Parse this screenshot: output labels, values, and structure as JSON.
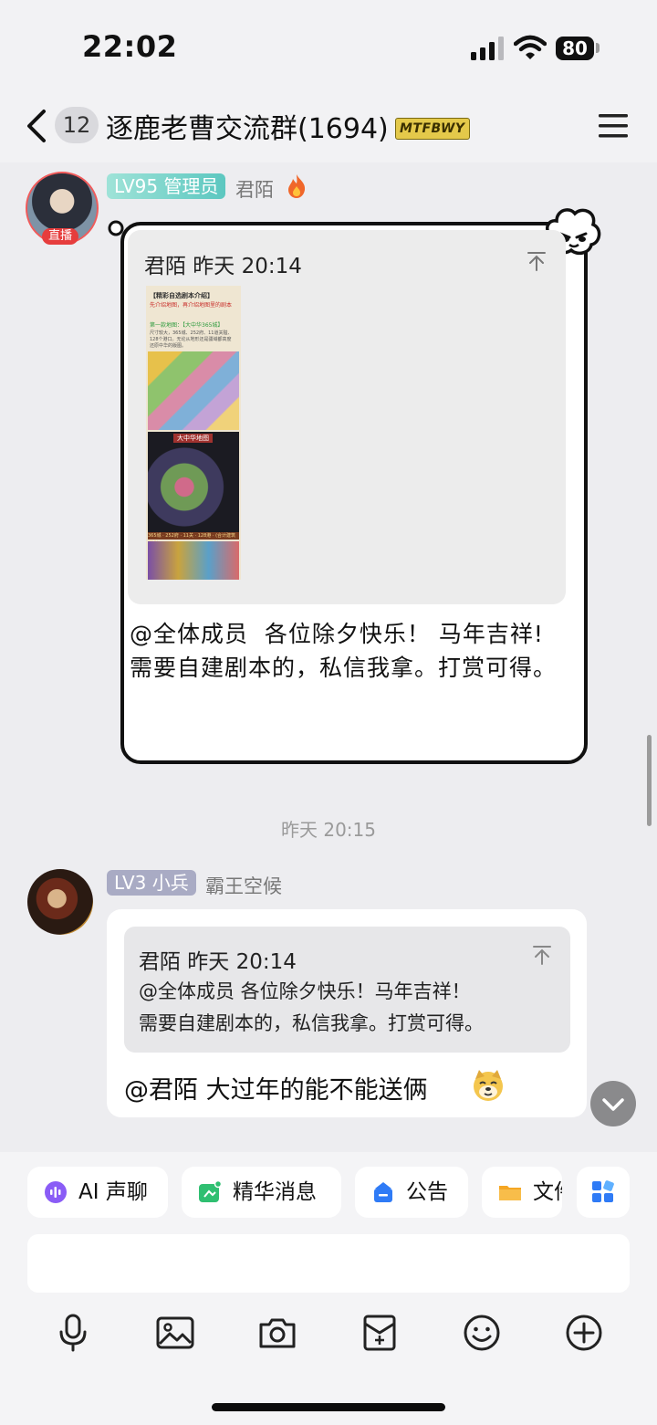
{
  "status_bar": {
    "time": "22:02",
    "battery": "80"
  },
  "nav": {
    "unread_count": "12",
    "group_title": "逐鹿老曹交流群(1694)",
    "brand_badge": "MTFBWY"
  },
  "messages": [
    {
      "avatar_tag": "直播",
      "level_badge": "LV95 管理员",
      "sender": "君陌",
      "quote": {
        "header": "君陌 昨天 20:14",
        "image": {
          "title": "【精彩自选剧本介绍】",
          "red_text": "先介绍地图，再介绍地图里的剧本",
          "green_text": "第一款地图：【大中华365城】",
          "body": "尺寸较大，365城、252府、11道关隘、128个港口。无论从地形还是疆域都高度还原中华的版图。",
          "map_label": "大中华地图",
          "strip_text": "365城 · 252府 · 11关 · 128港 · (合计建筑756)"
        }
      },
      "text": "@全体成员  各位除夕快乐！ 马年吉祥!\n需要自建剧本的，私信我拿。打赏可得。"
    },
    {
      "level_badge": "LV3 小兵",
      "sender": "霸王空候",
      "quote": {
        "header": "君陌 昨天 20:14",
        "line1": "@全体成员 各位除夕快乐！马年吉祥！",
        "line2": "需要自建剧本的，私信我拿。打赏可得。"
      },
      "text": "@君陌 大过年的能不能送俩",
      "emoji": "doge-emoji"
    }
  ],
  "timestamp": "昨天 20:15",
  "quick_actions": [
    "AI 声聊",
    "精华消息",
    "公告",
    "文件"
  ],
  "composer": {
    "tools": [
      "microphone-icon",
      "image-icon",
      "camera-icon",
      "red-packet-icon",
      "emoji-icon",
      "plus-icon"
    ]
  },
  "colors": {
    "admin_badge": "#5cc7c0",
    "soldier_badge": "#a9abc4",
    "live_red": "#e63d3d",
    "page_bg": "#ededf0"
  }
}
